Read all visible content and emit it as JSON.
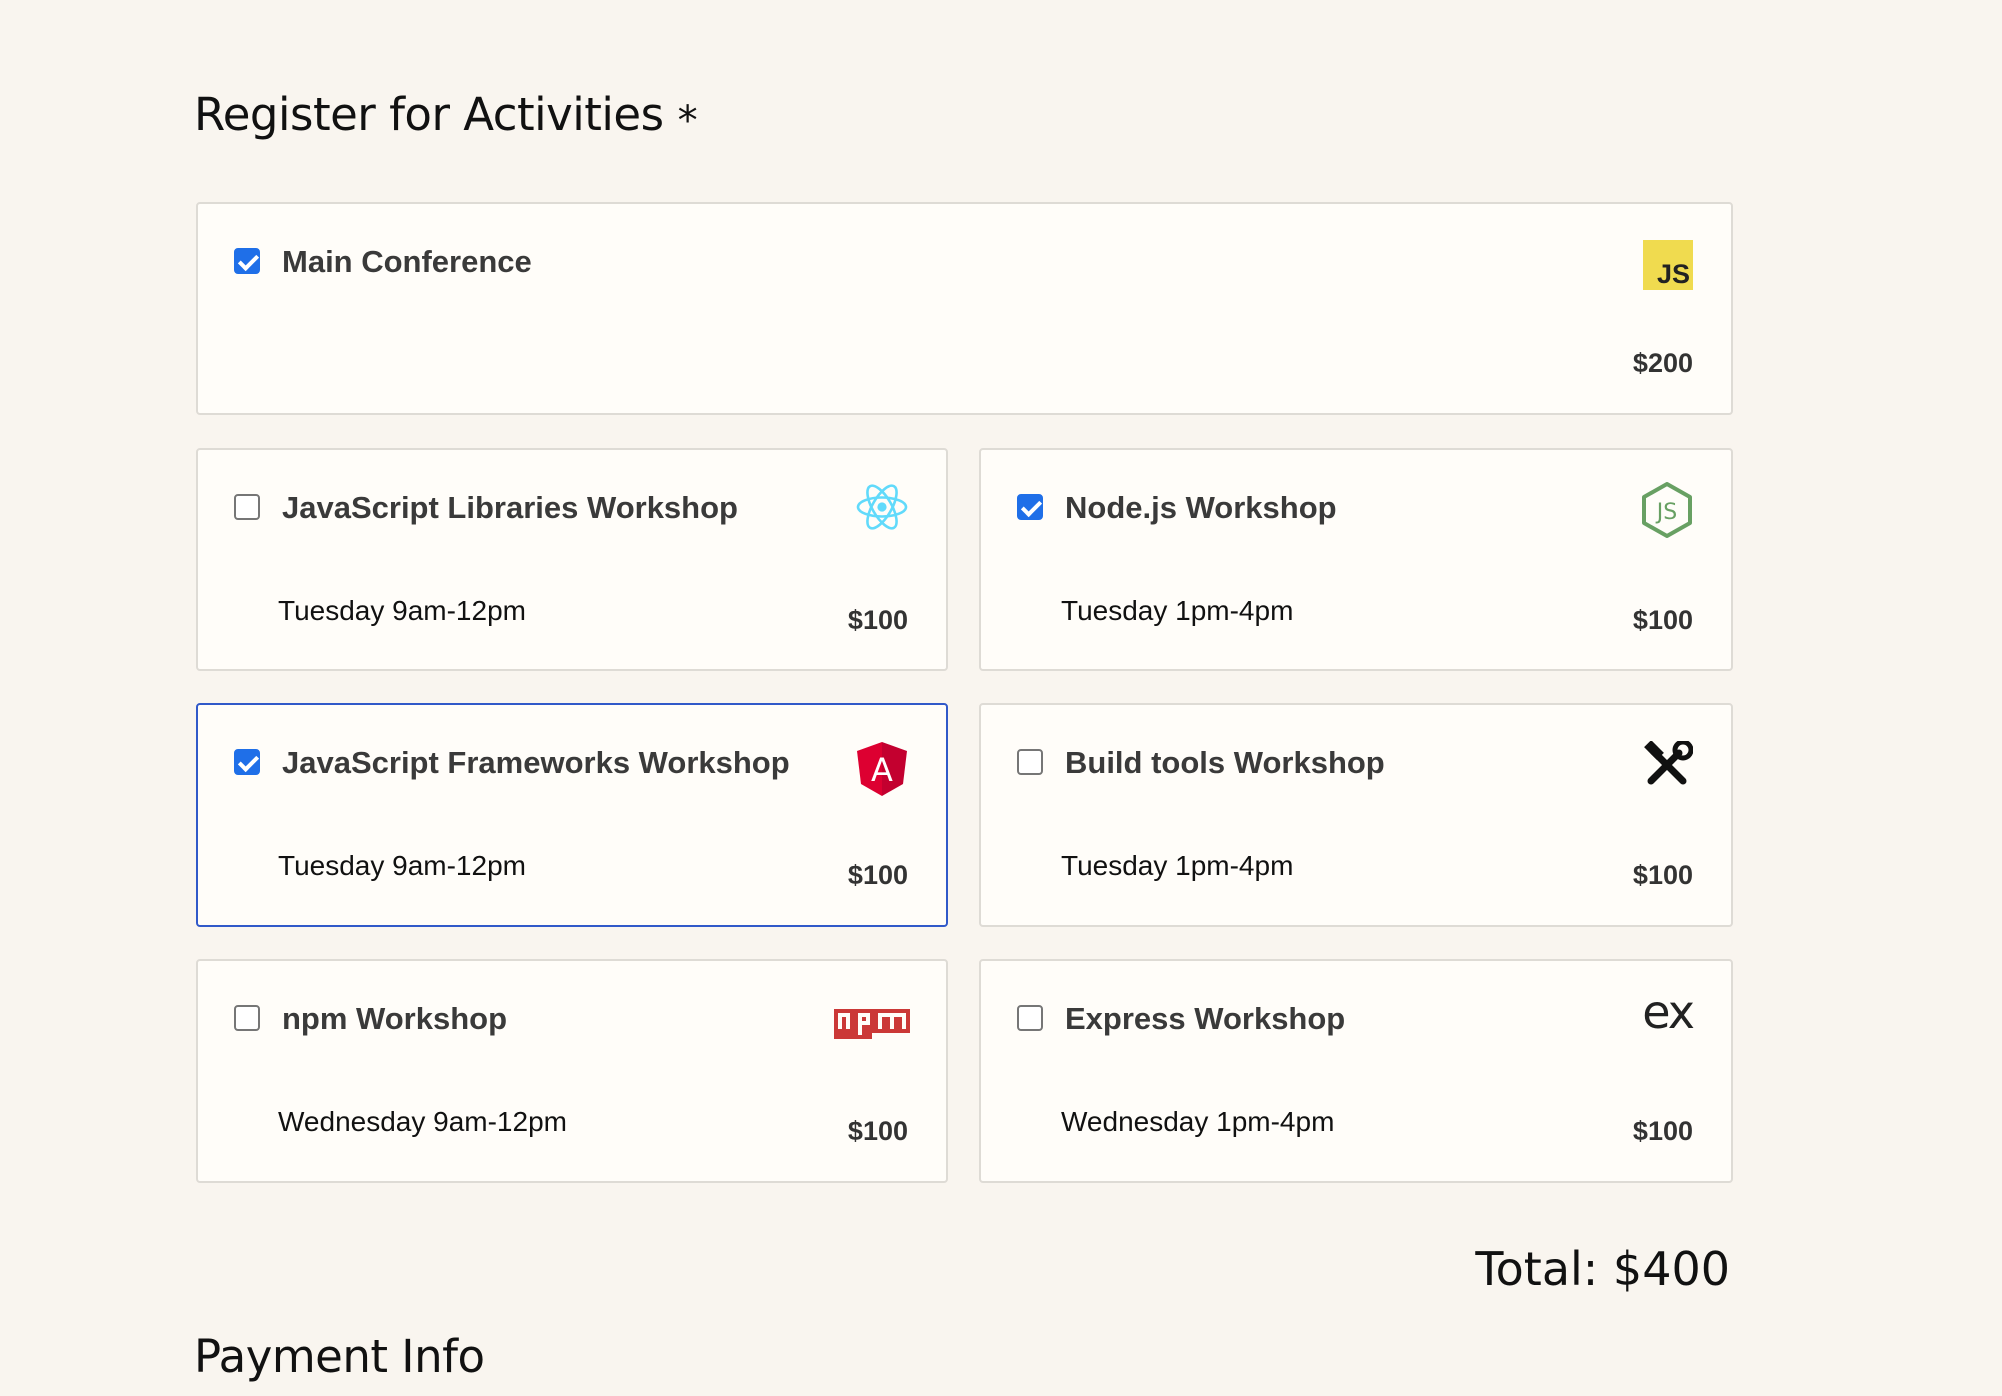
{
  "register": {
    "title": "Register for Activities",
    "required_marker": "*"
  },
  "activities": [
    {
      "name": "Main Conference",
      "time": "",
      "price": "$200",
      "checked": true,
      "icon": "javascript-icon",
      "icon_text": "JS"
    },
    {
      "name": "JavaScript Libraries Workshop",
      "time": "Tuesday 9am-12pm",
      "price": "$100",
      "checked": false,
      "icon": "react-icon"
    },
    {
      "name": "Node.js Workshop",
      "time": "Tuesday 1pm-4pm",
      "price": "$100",
      "checked": true,
      "icon": "nodejs-icon"
    },
    {
      "name": "JavaScript Frameworks Workshop",
      "time": "Tuesday 9am-12pm",
      "price": "$100",
      "checked": true,
      "focused": true,
      "icon": "angular-icon"
    },
    {
      "name": "Build tools Workshop",
      "time": "Tuesday 1pm-4pm",
      "price": "$100",
      "checked": false,
      "icon": "build-tools-icon"
    },
    {
      "name": "npm Workshop",
      "time": "Wednesday 9am-12pm",
      "price": "$100",
      "checked": false,
      "icon": "npm-icon"
    },
    {
      "name": "Express Workshop",
      "time": "Wednesday 1pm-4pm",
      "price": "$100",
      "checked": false,
      "icon": "express-icon",
      "icon_text": "ex"
    }
  ],
  "total": {
    "label": "Total: $400"
  },
  "payment": {
    "title": "Payment Info"
  },
  "colors": {
    "background": "#f9f5ef",
    "card": "#fffdf9",
    "checkbox_checked": "#1f6fe8",
    "focus_border": "#3159c9",
    "js_yellow": "#f0db4f",
    "react_blue": "#61dafb",
    "node_green": "#68a063",
    "angular_red": "#dd0031",
    "npm_red": "#cb3837"
  }
}
